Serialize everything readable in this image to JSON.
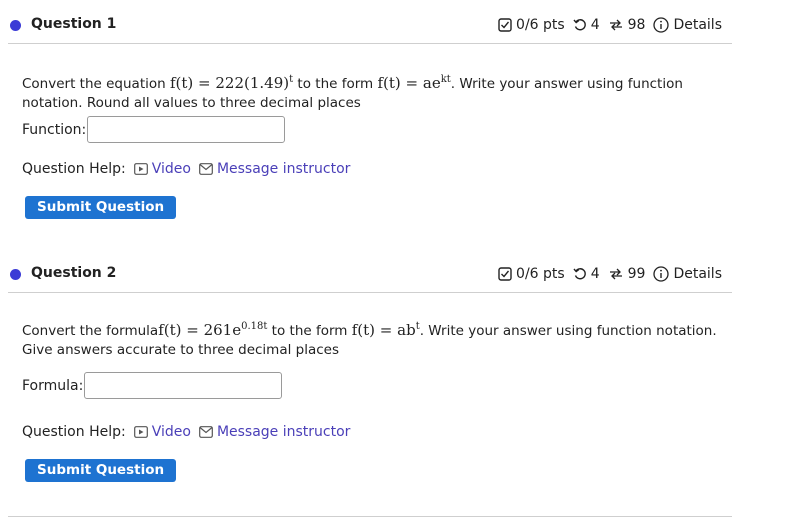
{
  "questions": [
    {
      "title": "Question 1",
      "pts": "0/6 pts",
      "retries": "4",
      "attempts": "98",
      "details": "Details",
      "text_before": "Convert the equation ",
      "math1": "f(t) = 222(1.49)",
      "math1_sup": "t",
      "text_middle": " to the form ",
      "math2": "f(t) = ae",
      "math2_sup": "kt",
      "text_after": ". Write your answer using function notation. Round all values to three decimal places",
      "field_label": "Function:",
      "field_value": "",
      "help_label": "Question Help:",
      "video_label": "Video",
      "message_label": "Message instructor",
      "submit_label": "Submit Question"
    },
    {
      "title": "Question 2",
      "pts": "0/6 pts",
      "retries": "4",
      "attempts": "99",
      "details": "Details",
      "text_before": "Convert the formula",
      "math1": "f(t) = 261e",
      "math1_sup": "0.18t",
      "text_middle": " to the form ",
      "math2": "f(t) = ab",
      "math2_sup": "t",
      "text_after": ". Write your answer using function notation. Give answers accurate to three decimal places",
      "field_label": "Formula:",
      "field_value": "",
      "help_label": "Question Help:",
      "video_label": "Video",
      "message_label": "Message instructor",
      "submit_label": "Submit Question"
    }
  ],
  "colors": {
    "accent": "#1e73d1",
    "link": "#4a3fb8",
    "dot": "#3b3bd6"
  },
  "icons": {
    "score": "checkbox-icon",
    "retry": "retry-icon",
    "attempts": "attempts-icon",
    "details": "info-icon",
    "video": "video-icon",
    "message": "mail-icon"
  }
}
